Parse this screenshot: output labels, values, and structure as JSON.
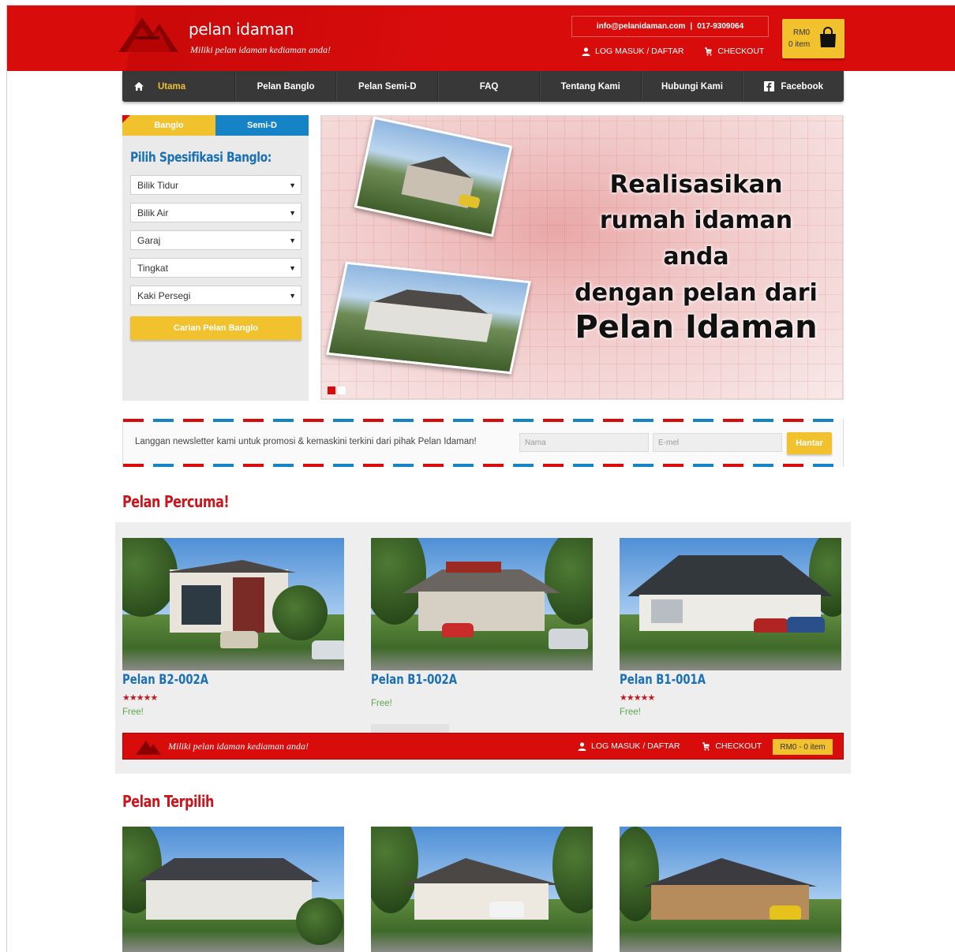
{
  "header": {
    "brand_name": "pelan idaman",
    "tagline": "Miliki pelan idaman kediaman anda!",
    "email": "info@pelanidaman.com",
    "separator": "|",
    "phone": "017-9309064",
    "login_label": "LOG MASUK / DAFTAR",
    "checkout_label": "CHECKOUT",
    "cart_amount": "RM0",
    "cart_count": "0 item",
    "brand_color": "#d90c0c",
    "accent_color": "#f2c12e"
  },
  "nav": {
    "items": [
      {
        "label": "Utama",
        "icon": "home-icon"
      },
      {
        "label": "Pelan Banglo"
      },
      {
        "label": "Pelan Semi-D"
      },
      {
        "label": "FAQ"
      },
      {
        "label": "Tentang Kami"
      },
      {
        "label": "Hubungi Kami"
      },
      {
        "label": "Facebook",
        "icon": "facebook-icon"
      }
    ]
  },
  "sidebar": {
    "tabs": [
      "Banglo",
      "Semi-D"
    ],
    "title": "Pilih Spesifikasi Banglo:",
    "selects": [
      "Bilik Tidur",
      "Bilik Air",
      "Garaj",
      "Tingkat",
      "Kaki Persegi"
    ],
    "search_button": "Carian Pelan Banglo"
  },
  "banner": {
    "lines": [
      "Realisasikan",
      "rumah idaman anda",
      "dengan pelan dari",
      "Pelan Idaman"
    ],
    "active_slide": 1,
    "slide_count": 2
  },
  "newsletter": {
    "text": "Langgan newsletter kami untuk promosi & kemaskini terkini dari pihak Pelan Idaman!",
    "name_placeholder": "Nama",
    "email_placeholder": "E-mel",
    "submit": "Hantar"
  },
  "free_section": {
    "title": "Pelan Percuma!",
    "items": [
      {
        "name": "Pelan B2-002A",
        "stars": "★★★★★",
        "price": "Free!"
      },
      {
        "name": "Pelan B1-002A",
        "stars": "",
        "price": "Free!"
      },
      {
        "name": "Pelan B1-001A",
        "stars": "★★★★★",
        "price": "Free!"
      }
    ]
  },
  "sticky_bar": {
    "tagline": "Miliki pelan idaman kediaman anda!",
    "login_label": "LOG MASUK / DAFTAR",
    "checkout_label": "CHECKOUT",
    "cart": "RM0 - 0 item"
  },
  "featured_section": {
    "title": "Pelan Terpilih"
  }
}
